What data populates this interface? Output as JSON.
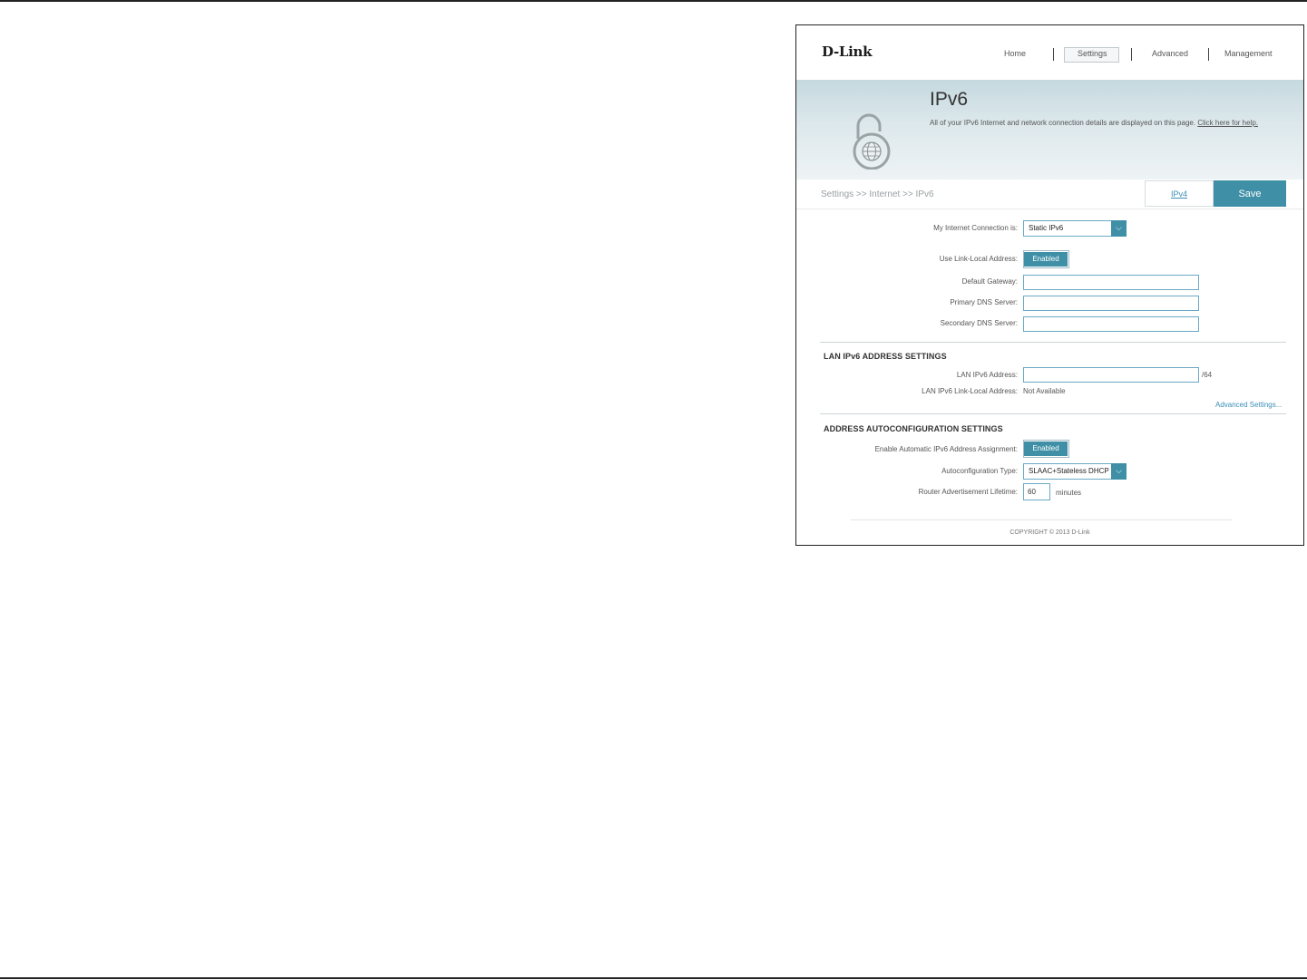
{
  "header": {
    "logo": "D-Link",
    "nav": [
      "Home",
      "Settings",
      "Advanced",
      "Management"
    ],
    "active_nav": "Settings"
  },
  "hero": {
    "title": "IPv6",
    "description": "All of your IPv6 Internet and network connection details are displayed on this page.",
    "help_link": "Click here for help."
  },
  "breadcrumb": "Settings >> Internet >> IPv6",
  "tabs": {
    "ipv4": "IPv4",
    "save": "Save"
  },
  "main": {
    "connection_label": "My Internet Connection is:",
    "connection_value": "Static IPv6",
    "link_local_label": "Use Link-Local Address:",
    "link_local_value": "Enabled",
    "gateway_label": "Default Gateway:",
    "gateway_value": "",
    "primary_dns_label": "Primary DNS Server:",
    "primary_dns_value": "",
    "secondary_dns_label": "Secondary DNS Server:",
    "secondary_dns_value": ""
  },
  "lan": {
    "title": "LAN IPv6 ADDRESS SETTINGS",
    "address_label": "LAN IPv6 Address:",
    "address_value": "",
    "address_suffix": "/64",
    "link_local_label": "LAN IPv6 Link-Local Address:",
    "link_local_value": "Not Available",
    "advanced_link": "Advanced Settings..."
  },
  "autoconfig": {
    "title": "ADDRESS AUTOCONFIGURATION SETTINGS",
    "enable_label": "Enable Automatic IPv6 Address Assignment:",
    "enable_value": "Enabled",
    "type_label": "Autoconfiguration Type:",
    "type_value": "SLAAC+Stateless DHCP",
    "lifetime_label": "Router Advertisement Lifetime:",
    "lifetime_value": "60",
    "lifetime_unit": "minutes"
  },
  "footer": "COPYRIGHT © 2013 D-Link",
  "icons": [
    "lock-globe-icon",
    "chevron-down-icon"
  ],
  "colors": {
    "accent": "#3f8fa6",
    "link": "#3a8fb7",
    "hero": "#c5d9df"
  }
}
